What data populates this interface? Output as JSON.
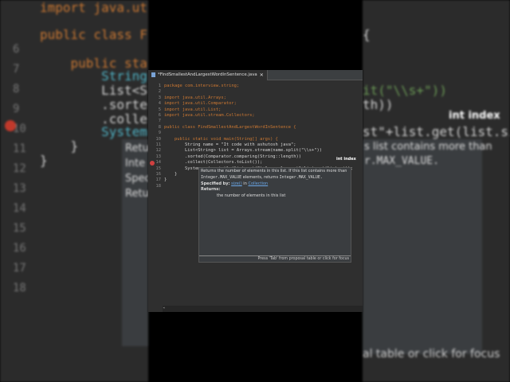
{
  "editor": {
    "tab_title": "*FindSmallestAndLargestWordInSentence.java",
    "lines": [
      {
        "n": "1",
        "code": "package com.interview.string;"
      },
      {
        "n": "2",
        "code": ""
      },
      {
        "n": "3",
        "code": "import java.util.Arrays;"
      },
      {
        "n": "4",
        "code": "import java.util.Comparator;"
      },
      {
        "n": "5",
        "code": "import java.util.List;"
      },
      {
        "n": "6",
        "code": "import java.util.stream.Collectors;"
      },
      {
        "n": "7",
        "code": ""
      },
      {
        "n": "8",
        "code": "public class FindSmallestAndLargestWordInSentence {"
      },
      {
        "n": "9",
        "code": ""
      },
      {
        "n": "10",
        "code": "    public static void main(String[] args) {"
      },
      {
        "n": "11",
        "code": "        String name = \"It code with ashutosh java\";"
      },
      {
        "n": "12",
        "code": "        List<String> list = Arrays.stream(name.split(\"\\\\s+\"))"
      },
      {
        "n": "13",
        "code": "        .sorted(Comparator.comparing(String::length))"
      },
      {
        "n": "14",
        "code": "        .collect(Collectors.toList());"
      },
      {
        "n": "15",
        "code": "        System.out.println(list.get(0)+\"<--> largest\"+list.get(list.si));"
      },
      {
        "n": "16",
        "code": "    }"
      },
      {
        "n": "17",
        "code": "}"
      },
      {
        "n": "18",
        "code": ""
      }
    ],
    "param_hint": "int index",
    "popup": {
      "line1": "Returns the number of elements in this list. If this list contains more than",
      "line2_code1": "Integer.MAX_VALUE",
      "line2_text": " elements, returns ",
      "line2_code2": "Integer.MAX_VALUE.",
      "specified_label": "Specified by:",
      "specified_method": "size()",
      "specified_in": " in ",
      "specified_class": "Collection",
      "returns_label": "Returns:",
      "returns_text": "the number of elements in this list",
      "footer": "Press 'Tab' from proposal table or click for focus"
    }
  },
  "background_left": {
    "lines": [
      "import java.util.",
      "public class Find",
      "    public static",
      "        String na",
      "        List<Stri",
      "        .sorted(C",
      "        .collect(",
      "        System.ou",
      "    }",
      "}"
    ],
    "gutter": [
      "6",
      "7",
      "8",
      "9",
      "10",
      "11",
      "12",
      "13",
      "14",
      "15",
      "16",
      "17",
      "18"
    ],
    "tooltip": [
      "Retu",
      "Inte",
      "Spec",
      "Retu"
    ]
  },
  "background_right": {
    "lines": [
      "{",
      "it(\"\\\\s+\"))",
      "th))",
      "st\"+list.get(list.si));",
      "s list contains more than",
      "r.MAX_VALUE."
    ],
    "hint": "int index",
    "footer": "al table or click for focus"
  }
}
